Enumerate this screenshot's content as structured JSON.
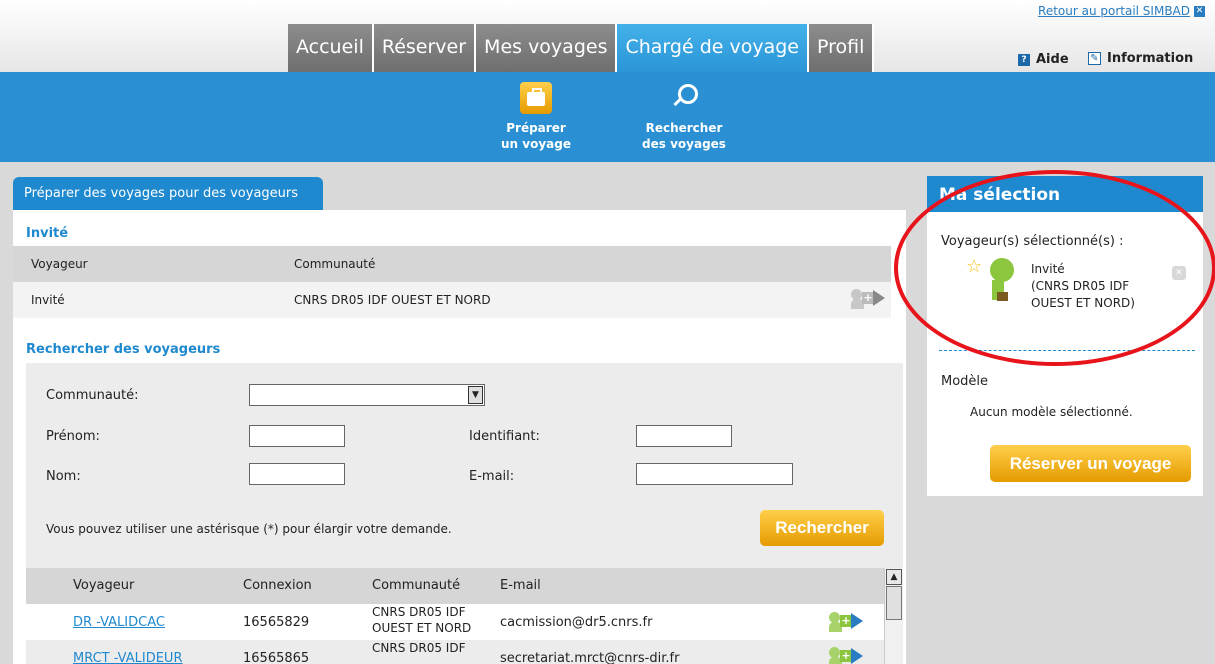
{
  "header": {
    "portal_link": "Retour au portail SIMBAD",
    "tabs": [
      "Accueil",
      "Réserver",
      "Mes voyages",
      "Chargé de voyage",
      "Profil"
    ],
    "active_tab": "Chargé de voyage",
    "help": "Aide",
    "information": "Information"
  },
  "subnav": [
    {
      "label": "Préparer un voyage",
      "icon": "suitcase-icon"
    },
    {
      "label": "Rechercher des voyages",
      "icon": "magnifier-icon"
    }
  ],
  "main": {
    "tab_title": "Préparer des voyages pour des voyageurs",
    "guest_section": {
      "title": "Invité",
      "headers": [
        "Voyageur",
        "Communauté"
      ],
      "row": {
        "voyageur": "Invité",
        "communaute": "CNRS DR05 IDF OUEST ET NORD"
      }
    },
    "search_section": {
      "title": "Rechercher des voyageurs",
      "communaute_label": "Communauté:",
      "prenom_label": "Prénom:",
      "identifiant_label": "Identifiant:",
      "nom_label": "Nom:",
      "email_label": "E-mail:",
      "hint": "Vous pouvez utiliser une astérisque (*) pour élargir votre demande.",
      "search_button": "Rechercher"
    },
    "results": {
      "headers": [
        "Voyageur",
        "Connexion",
        "Communauté",
        "E-mail"
      ],
      "rows": [
        {
          "voyageur": "DR -VALIDCAC",
          "connexion": "16565829",
          "communaute_l1": "CNRS DR05 IDF",
          "communaute_l2": "OUEST ET NORD",
          "email": "cacmission@dr5.cnrs.fr"
        },
        {
          "voyageur": "MRCT -VALIDEUR",
          "connexion": "16565865",
          "communaute_l1": "CNRS DR05 IDF",
          "communaute_l2": "",
          "email": "secretariat.mrct@cnrs-dir.fr"
        }
      ]
    }
  },
  "sidebar": {
    "title": "Ma sélection",
    "selected_label": "Voyageur(s) sélectionné(s) :",
    "selected": {
      "name": "Invité",
      "line2": "(CNRS DR05 IDF",
      "line3": "OUEST ET NORD)"
    },
    "model_label": "Modèle",
    "model_value": "Aucun modèle sélectionné.",
    "reserve_button": "Réserver un voyage"
  },
  "colors": {
    "accent": "#1f89cf",
    "orange": "#f0a81c",
    "annotation": "#e8141b"
  }
}
